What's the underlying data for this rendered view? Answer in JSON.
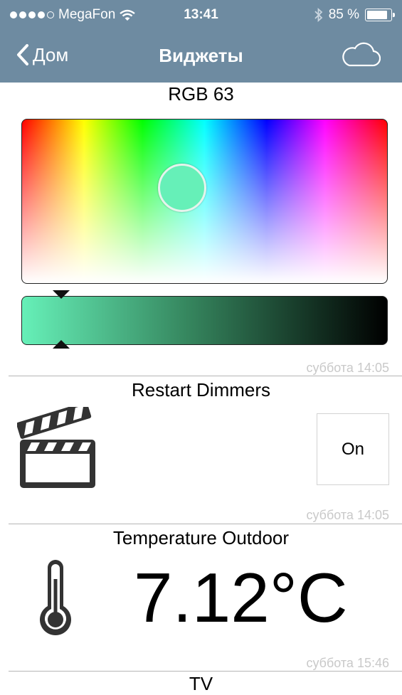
{
  "status_bar": {
    "carrier": "MegaFon",
    "time": "13:41",
    "battery": "85 %"
  },
  "nav": {
    "back_label": "Дом",
    "title": "Виджеты"
  },
  "widgets": {
    "rgb": {
      "title": "RGB 63",
      "selected_color": "#66f0b8",
      "timestamp": "суббота 14:05"
    },
    "restart": {
      "title": "Restart Dimmers",
      "button_label": "On",
      "timestamp": "суббота 14:05"
    },
    "temperature": {
      "title": "Temperature Outdoor",
      "value": "7.12°C",
      "timestamp": "суббота 15:46"
    },
    "tv": {
      "title": "TV"
    }
  },
  "icons": [
    "signal-dots-icon",
    "wifi-icon",
    "bluetooth-icon",
    "battery-icon",
    "back-chevron-icon",
    "cloud-icon",
    "clapperboard-icon",
    "thermometer-icon"
  ],
  "colors": {
    "navbar": "#6e8ba1",
    "timestamp": "#c9c9c9"
  }
}
